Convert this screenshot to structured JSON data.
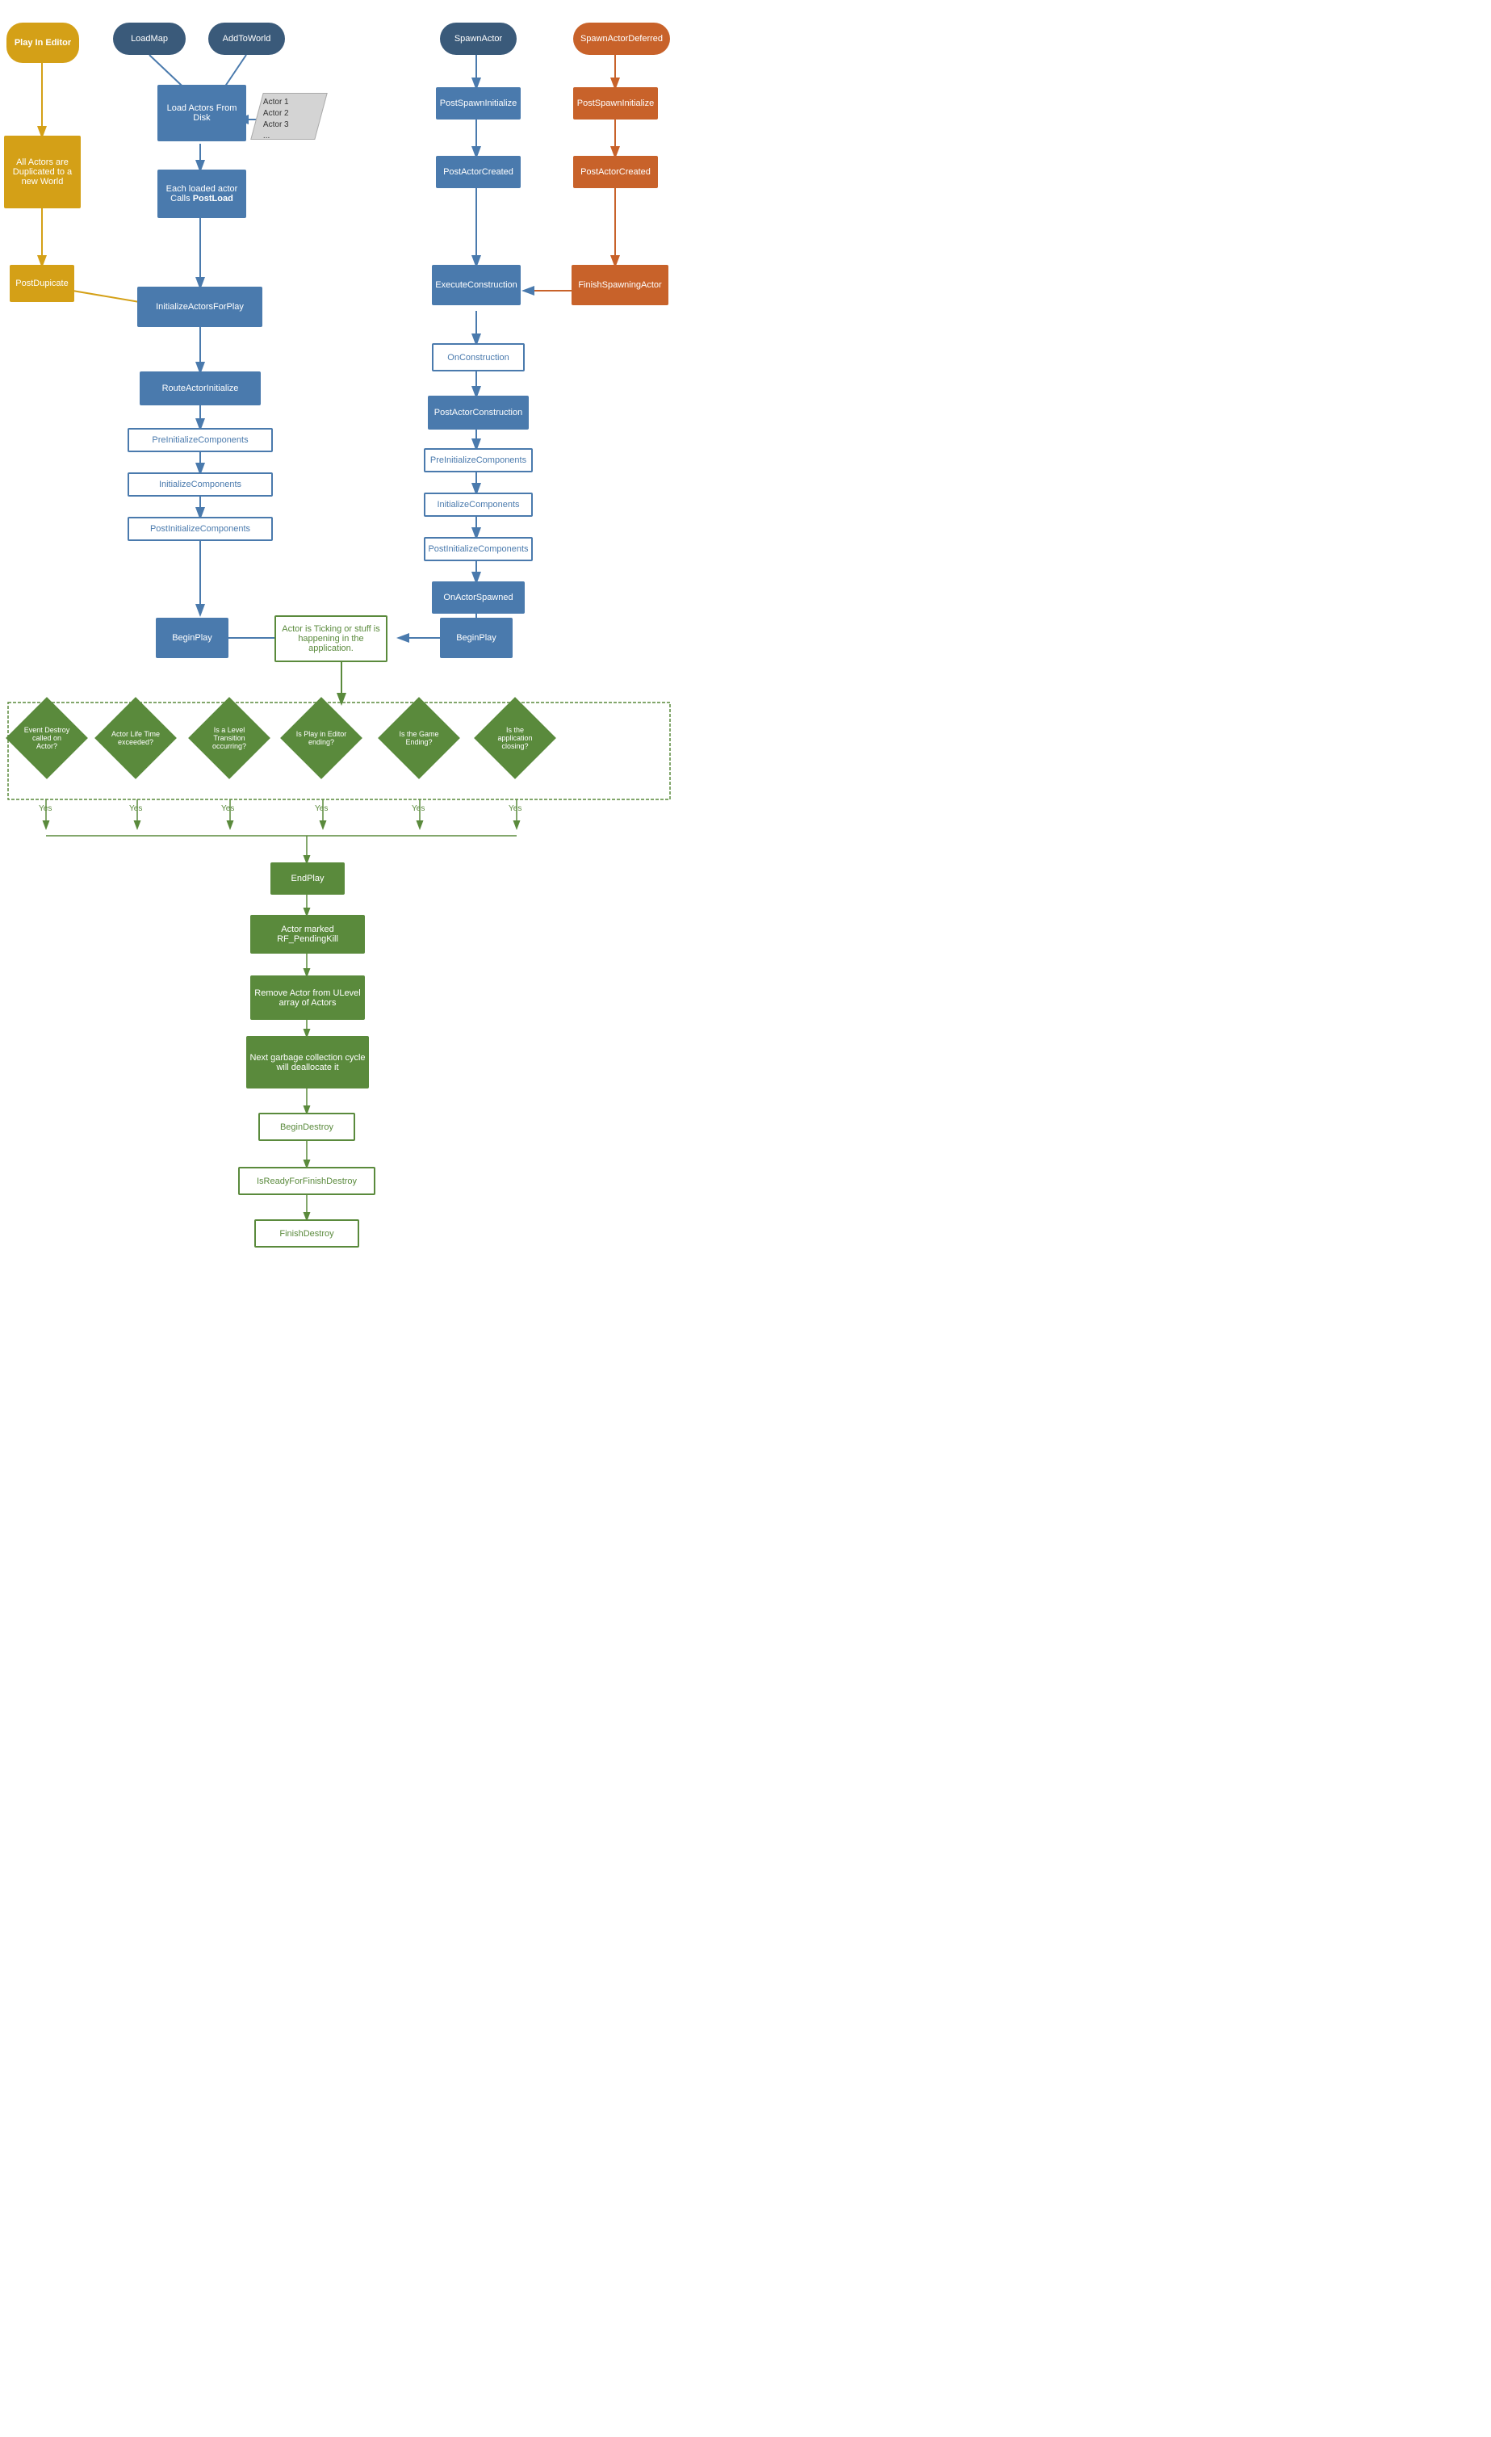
{
  "nodes": {
    "playInEditor": {
      "label": "Play In Editor"
    },
    "loadMap": {
      "label": "LoadMap"
    },
    "addToWorld": {
      "label": "AddToWorld"
    },
    "spawnActor": {
      "label": "SpawnActor"
    },
    "spawnActorDeferred": {
      "label": "SpawnActorDeferred"
    },
    "loadActorsFromDisk": {
      "label": "Load Actors From Disk"
    },
    "actorList": {
      "label": "Actor 1\nActor 2\nActor 3\n..."
    },
    "eachLoadedActor": {
      "label": "Each loaded actor Calls PostLoad"
    },
    "postSpawnInitializeBlue": {
      "label": "PostSpawnInitialize"
    },
    "postSpawnInitializeOrange": {
      "label": "PostSpawnInitialize"
    },
    "postActorCreatedBlue": {
      "label": "PostActorCreated"
    },
    "postActorCreatedOrange": {
      "label": "PostActorCreated"
    },
    "allActorsDuplicated": {
      "label": "All Actors are Duplicated to a new World"
    },
    "postDuplicate": {
      "label": "PostDupicate"
    },
    "initializeActorsForPlay": {
      "label": "InitializeActorsForPlay"
    },
    "executeConstruction": {
      "label": "ExecuteConstruction"
    },
    "finishSpawningActor": {
      "label": "FinishSpawningActor"
    },
    "onConstruction": {
      "label": "OnConstruction"
    },
    "routeActorInitialize": {
      "label": "RouteActorInitialize"
    },
    "postActorConstruction": {
      "label": "PostActorConstruction"
    },
    "preInitializeComponentsLeft": {
      "label": "PreInitializeComponents"
    },
    "initializeComponentsLeft": {
      "label": "InitializeComponents"
    },
    "postInitializeComponentsLeft": {
      "label": "PostInitializeComponents"
    },
    "preInitializeComponentsRight": {
      "label": "PreInitializeComponents"
    },
    "initializeComponentsRight": {
      "label": "InitializeComponents"
    },
    "postInitializeComponentsRight": {
      "label": "PostInitializeComponents"
    },
    "onActorSpawned": {
      "label": "OnActorSpawned"
    },
    "beginPlayLeft": {
      "label": "BeginPlay"
    },
    "beginPlayRight": {
      "label": "BeginPlay"
    },
    "actorTicking": {
      "label": "Actor is Ticking or stuff is happening in the application."
    },
    "eventDestroyDiamond": {
      "label": "Event Destroy called on Actor?"
    },
    "actorLifeTimeDiamond": {
      "label": "Actor Life Time exceeded?"
    },
    "levelTransitionDiamond": {
      "label": "Is a Level Transition occurring?"
    },
    "playInEditorEndingDiamond": {
      "label": "Is Play in Editor ending?"
    },
    "gameEndingDiamond": {
      "label": "Is the Game Ending?"
    },
    "appClosingDiamond": {
      "label": "Is the application closing?"
    },
    "endPlay": {
      "label": "EndPlay"
    },
    "actorMarked": {
      "label": "Actor marked RF_PendingKill"
    },
    "removeActor": {
      "label": "Remove Actor from ULevel array of Actors"
    },
    "nextGarbage": {
      "label": "Next garbage collection cycle will deallocate it"
    },
    "beginDestroy": {
      "label": "BeginDestroy"
    },
    "isReadyForFinishDestroy": {
      "label": "IsReadyForFinishDestroy"
    },
    "finishDestroy": {
      "label": "FinishDestroy"
    },
    "yesLabels": [
      "Yes",
      "Yes",
      "Yes",
      "Yes",
      "Yes",
      "Yes"
    ]
  }
}
